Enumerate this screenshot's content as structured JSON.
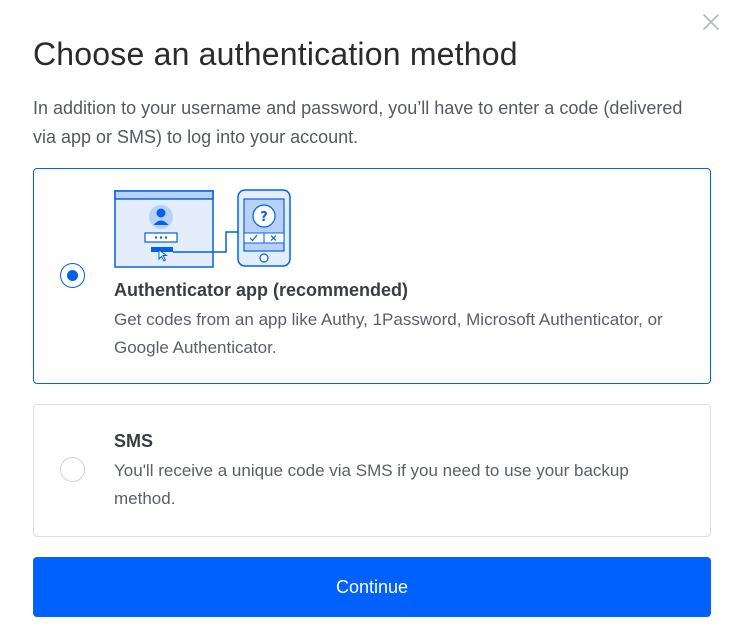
{
  "dialog": {
    "title": "Choose an authentication method",
    "description": "In addition to your username and password, you’ll have to enter a code (delivered via app or SMS) to log into your account.",
    "close_icon": "close-icon"
  },
  "options": [
    {
      "id": "authenticator",
      "title": "Authenticator app (recommended)",
      "description": "Get codes from an app like Authy, 1Password, Microsoft Authenticator, or Google Authenticator.",
      "selected": true,
      "illustration": "authenticator-illustration"
    },
    {
      "id": "sms",
      "title": "SMS",
      "description": "You'll receive a unique code via SMS if you need to use your backup method.",
      "selected": false
    }
  ],
  "continue_label": "Continue",
  "colors": {
    "accent": "#0061fe",
    "selected_border": "#0061eb",
    "unselected_border": "#dcdfe3",
    "illustration_fill": "#e3edfc"
  }
}
